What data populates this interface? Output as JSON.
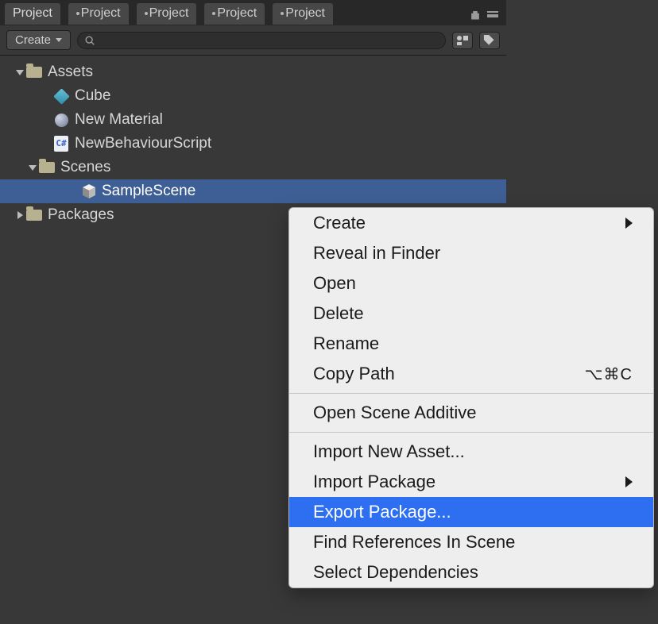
{
  "tabs": [
    "Project",
    "Project",
    "Project",
    "Project",
    "Project"
  ],
  "toolbar": {
    "create": "Create"
  },
  "tree": {
    "assets": "Assets",
    "cube": "Cube",
    "material": "New Material",
    "script": "NewBehaviourScript",
    "script_badge": "C#",
    "scenes": "Scenes",
    "sample_scene": "SampleScene",
    "packages": "Packages"
  },
  "menu": {
    "create": "Create",
    "reveal": "Reveal in Finder",
    "open": "Open",
    "delete": "Delete",
    "rename": "Rename",
    "copy_path": "Copy Path",
    "copy_path_shortcut": "⌥⌘C",
    "open_additive": "Open Scene Additive",
    "import_asset": "Import New Asset...",
    "import_package": "Import Package",
    "export_package": "Export Package...",
    "find_refs": "Find References In Scene",
    "select_deps": "Select Dependencies"
  }
}
